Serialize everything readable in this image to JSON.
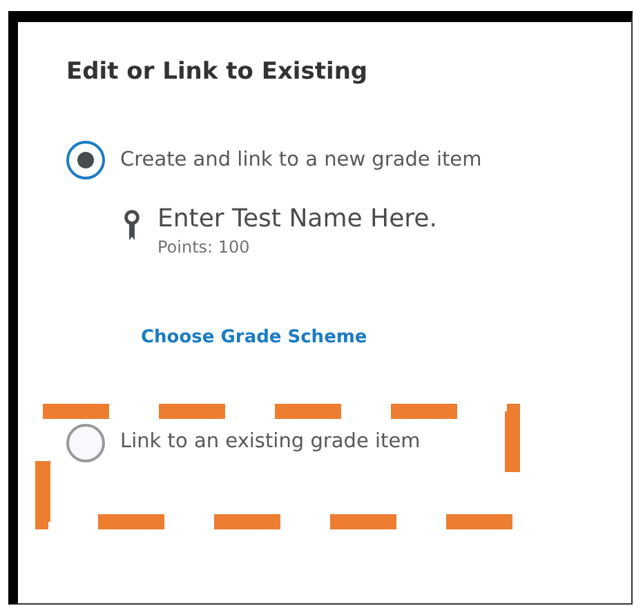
{
  "panel": {
    "title": "Edit or Link to Existing"
  },
  "options": [
    {
      "label": "Create and link to a new grade item",
      "selected": true,
      "details": {
        "name": "Enter Test Name Here.",
        "points": "Points: 100",
        "link": "Choose Grade Scheme"
      }
    },
    {
      "label": "Link to an existing grade item",
      "selected": false
    }
  ]
}
